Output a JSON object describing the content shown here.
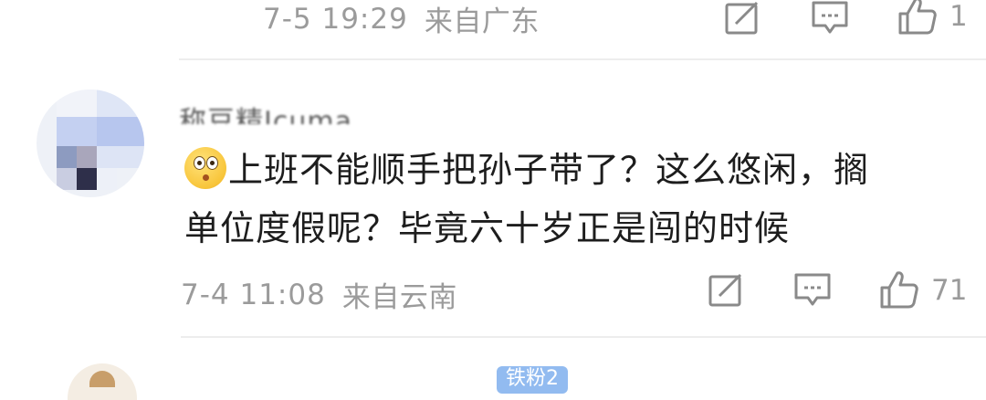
{
  "top_comment": {
    "time": "7-5 19:29",
    "location": "来自广东",
    "like_count": "1"
  },
  "main_comment": {
    "username": "称豆精Jcuma",
    "emoji": "sweat-surprised-face-emoji",
    "text_line1": "上班不能顺手把孙子带了？这么悠闲，搁",
    "text_line2": "单位度假呢？毕竟六十岁正是闯的时候",
    "time": "7-4 11:08",
    "location": "来自云南",
    "like_count": "71"
  },
  "next_comment": {
    "badge": "铁粉2"
  },
  "icons": {
    "share": "share-icon",
    "comment": "comment-icon",
    "like": "thumbs-up-icon"
  },
  "colors": {
    "meta_text": "#9b9b9b",
    "icon_stroke": "#8a8a8a",
    "badge": "#7fb0ee"
  }
}
